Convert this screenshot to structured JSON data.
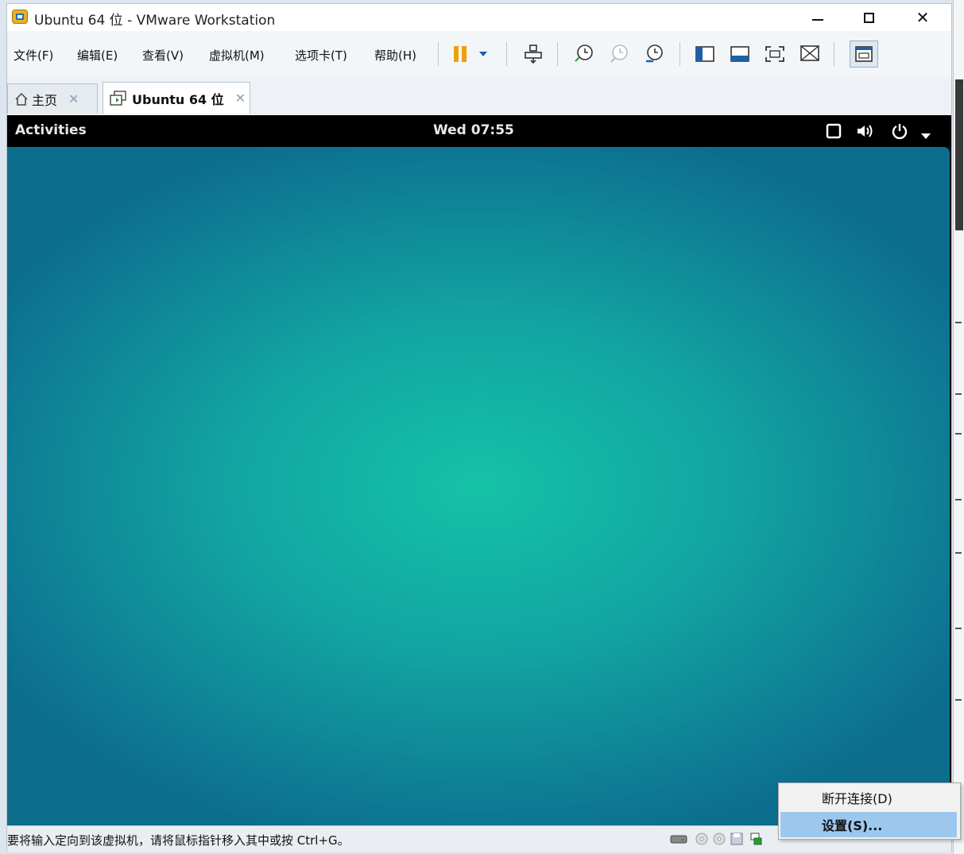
{
  "window": {
    "title": "Ubuntu 64 位 - VMware Workstation"
  },
  "menu": {
    "items": [
      "文件(F)",
      "编辑(E)",
      "查看(V)",
      "虚拟机(M)",
      "选项卡(T)",
      "帮助(H)"
    ]
  },
  "toolbar": {
    "icons": [
      "pause-icon",
      "dropdown-icon",
      "send-ctrl-alt-del-icon",
      "snapshot-take-icon",
      "snapshot-revert-icon",
      "snapshot-manager-icon",
      "library-view-icon",
      "console-view-icon",
      "fullscreen-icon",
      "unity-icon",
      "thumbnail-icon"
    ]
  },
  "tabs": [
    {
      "label": "主页",
      "icon": "home-icon",
      "active": false
    },
    {
      "label": "Ubuntu 64 位",
      "icon": "vm-icon",
      "active": true
    }
  ],
  "guest": {
    "activities": "Activities",
    "clock": "Wed 07:55",
    "indicators": [
      "window-icon",
      "volume-icon",
      "power-icon",
      "chevron-down-icon"
    ]
  },
  "statusbar": {
    "message": "要将输入定向到该虚拟机，请将鼠标指针移入其中或按 Ctrl+G。"
  },
  "context_menu": {
    "items": [
      "断开连接(D)",
      "设置(S)..."
    ],
    "highlighted": "设置(S)..."
  },
  "colors": {
    "highlight": "#9dc8ee",
    "desktop_center": "#15c2a6",
    "desktop_edge": "#0c6d8d",
    "pause_orange": "#f0a000"
  }
}
